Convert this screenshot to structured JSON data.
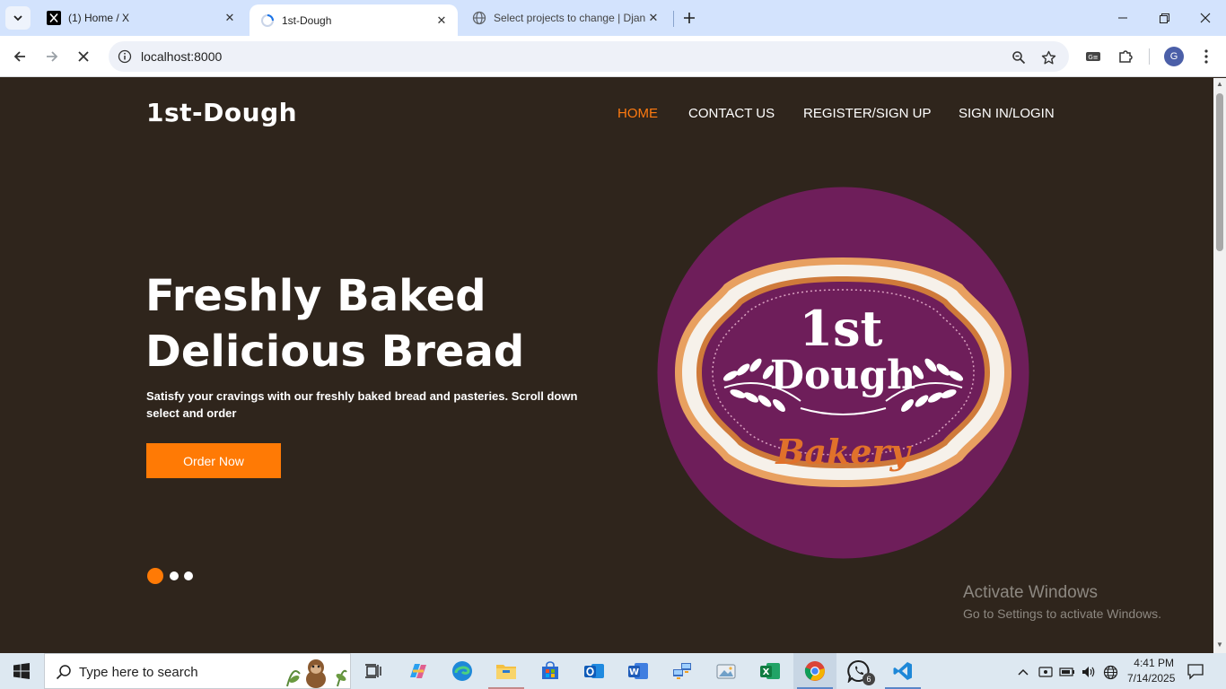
{
  "browser": {
    "tabs": [
      {
        "title": "(1) Home / X",
        "icon": "x-logo-icon",
        "active": false
      },
      {
        "title": "1st-Dough",
        "icon": "loading-spinner-icon",
        "active": true
      },
      {
        "title": "Select projects to change | Djan",
        "icon": "globe-icon",
        "active": false
      }
    ],
    "url": "localhost:8000",
    "profile_initial": "G"
  },
  "page": {
    "brand": "1st-Dough",
    "nav": [
      {
        "label": "HOME",
        "active": true
      },
      {
        "label": "CONTACT US",
        "active": false
      },
      {
        "label": "REGISTER/SIGN UP",
        "active": false
      },
      {
        "label": "SIGN IN/LOGIN",
        "active": false
      }
    ],
    "hero": {
      "title_line1": "Freshly Baked",
      "title_line2": "Delicious Bread",
      "subtitle": "Satisfy your cravings with our freshly baked bread and pasteries. Scroll down select and order",
      "button": "Order Now"
    },
    "carousel": {
      "slides": 3,
      "active_index": 0
    },
    "logo": {
      "line1": "1st",
      "line2": "Dough",
      "line3": "Bakery"
    },
    "watermark": {
      "line1": "Activate Windows",
      "line2": "Go to Settings to activate Windows."
    }
  },
  "taskbar": {
    "search_placeholder": "Type here to search",
    "whatsapp_badge": "6",
    "time": "4:41 PM",
    "date": "7/14/2025"
  },
  "colors": {
    "page_bg": "#2f251c",
    "accent": "#ff7a05",
    "logo_purple": "#6e1e5a"
  }
}
